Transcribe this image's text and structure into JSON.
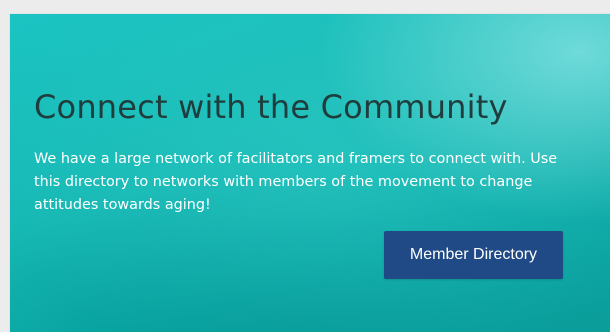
{
  "hero": {
    "title": "Connect with the Community",
    "description": "We have a large network of facilitators and framers to connect with. Use this directory to networks with members of the movement to change attitudes towards aging!",
    "cta_label": "Member Directory"
  },
  "colors": {
    "panel_teal": "#16b8b4",
    "title_text": "#1f3d3d",
    "body_text": "#ffffff",
    "button_bg": "#1f4a86",
    "button_text": "#ffffff",
    "page_bg": "#ececec"
  }
}
